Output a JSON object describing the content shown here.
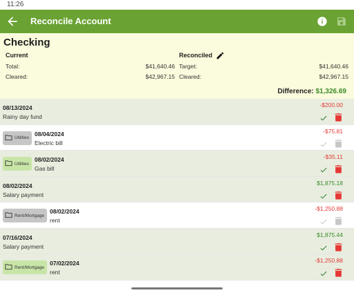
{
  "status_bar": {
    "time": "11:26"
  },
  "app_bar": {
    "title": "Reconcile Account"
  },
  "summary": {
    "account_name": "Checking",
    "current_header": "Current",
    "reconciled_header": "Reconciled",
    "total_label": "Total:",
    "total_value": "$41,640.46",
    "cleared_label": "Cleared:",
    "cleared_value": "$42,967.15",
    "target_label": "Target:",
    "target_value": "$41,640.46",
    "rec_cleared_label": "Cleared:",
    "rec_cleared_value": "$42,967.15",
    "difference_label": "Difference:",
    "difference_value": "$1,326.69"
  },
  "transactions": [
    {
      "date": "08/13/2024",
      "description": "Rainy day fund",
      "amount": "-$200.00",
      "category": "",
      "cleared": true
    },
    {
      "date": "08/04/2024",
      "description": "Electric bill",
      "amount": "-$75.81",
      "category": "Utilities",
      "cleared": false
    },
    {
      "date": "08/02/2024",
      "description": "Gas bill",
      "amount": "-$35.11",
      "category": "Utilities",
      "cleared": true
    },
    {
      "date": "08/02/2024",
      "description": "Salary payment",
      "amount": "$1,875.18",
      "category": "",
      "cleared": true
    },
    {
      "date": "08/02/2024",
      "description": "rent",
      "amount": "-$1,250.88",
      "category": "Rent/Mortgage",
      "cleared": false
    },
    {
      "date": "07/16/2024",
      "description": "Salary payment",
      "amount": "$1,875.44",
      "category": "",
      "cleared": true
    },
    {
      "date": "07/02/2024",
      "description": "rent",
      "amount": "-$1,250.88",
      "category": "Rent/Mortgage",
      "cleared": true
    }
  ],
  "colors": {
    "accent": "#6aa233",
    "summary_bg": "#fbfbdd",
    "negative": "#e53935",
    "positive": "#3c8c2a",
    "cleared_row": "#e8eddf"
  }
}
